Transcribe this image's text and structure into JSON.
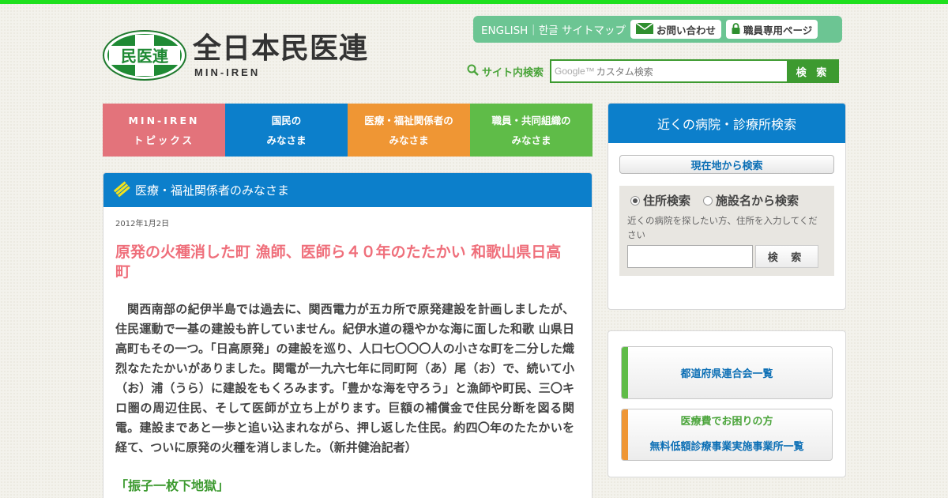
{
  "header": {
    "logo_mark_text": "民医連",
    "logo_title": "全日本民医連",
    "logo_sub": "MIN-IREN",
    "util_links": "ENGLISH｜한글 サイトマップ",
    "contact_label": "お問い合わせ",
    "staff_label": "職員専用ページ",
    "search_label": "サイト内検索",
    "search_placeholder": "カスタム検索",
    "search_google": "Google™",
    "search_button": "検 索"
  },
  "nav": [
    {
      "line1": "MIN-IREN",
      "line2": "トピックス"
    },
    {
      "line1": "国民の",
      "line2": "みなさま"
    },
    {
      "line1": "医療・福祉関係者の",
      "line2": "みなさま"
    },
    {
      "line1": "職員・共同組織の",
      "line2": "みなさま"
    }
  ],
  "article": {
    "section": "医療・福祉関係者のみなさま",
    "date": "2012年1月2日",
    "title": "原発の火種消した町 漁師、医師ら４０年のたたかい 和歌山県日高町",
    "body": "関西南部の紀伊半島では過去に、関西電力が五カ所で原発建設を計画しましたが、住民運動で一基の建設も許していません。紀伊水道の穏やかな海に面した和歌 山県日高町もその一つ。「日高原発」の建設を巡り、人口七〇〇〇人の小さな町を二分した熾烈なたたかいがありました。関電が一九六七年に同町阿（あ）尾（お）で、続いて小（お）浦（うら）に建設をもくろみます。「豊かな海を守ろう」と漁師や町民、三〇キロ圏の周辺住民、そして医師が立ち上がります。巨額の補償金で住民分断を図る関電。建設まであと一歩と追い込まれながら、押し返した住民。約四〇年のたたかいを経て、ついに原発の火種を消しました。（新井健治記者）",
    "subheading": "「振子一枚下地獄」"
  },
  "finder": {
    "title": "近くの病院・診療所検索",
    "location_button": "現在地から検索",
    "radio_address": "住所検索",
    "radio_facility": "施設名から検索",
    "hint": "近くの病院を探したい方、住所を入力してください",
    "search_button": "検 索"
  },
  "links": {
    "prefecture": "都道府県連合会一覧",
    "medical_cost_line1": "医療費でお困りの方",
    "medical_cost_line2": "無料低額診療事業実施事業所一覧"
  },
  "colors": {
    "top_bar": "#1ee01e",
    "nav_topics": "#e3737b",
    "nav_public": "#0c7fcb",
    "nav_medical": "#ef9634",
    "nav_staff": "#5fbc48",
    "title_pink": "#ef6f7b",
    "link_blue": "#0c6fb5"
  }
}
